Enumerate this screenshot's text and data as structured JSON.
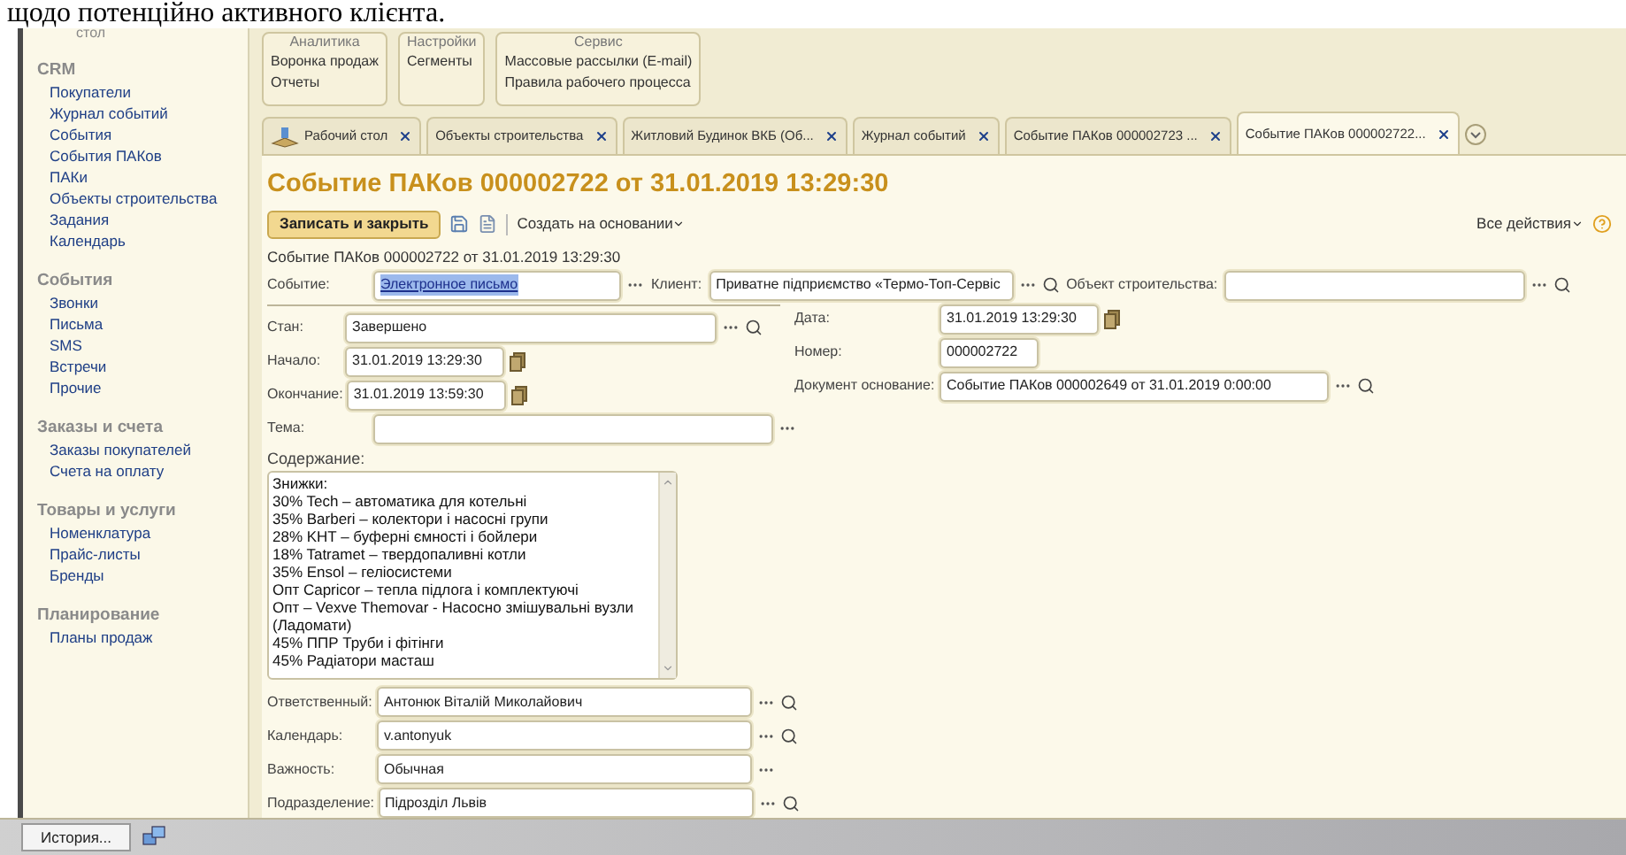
{
  "caption": "щодо потенційно активного клієнта.",
  "sidebar": {
    "top_item": "стол",
    "sections": [
      {
        "heading": "CRM",
        "items": [
          "Покупатели",
          "Журнал событий",
          "События",
          "События ПАКов",
          "ПАКи",
          "Объекты строительства",
          "Задания",
          "Календарь"
        ]
      },
      {
        "heading": "События",
        "items": [
          "Звонки",
          "Письма",
          "SMS",
          "Встречи",
          "Прочие"
        ]
      },
      {
        "heading": "Заказы и счета",
        "items": [
          "Заказы покупателей",
          "Счета на оплату"
        ]
      },
      {
        "heading": "Товары и услуги",
        "items": [
          "Номенклатура",
          "Прайс-листы",
          "Бренды"
        ]
      },
      {
        "heading": "Планирование",
        "items": [
          "Планы продаж"
        ]
      }
    ]
  },
  "command_groups": [
    {
      "title": "Аналитика",
      "items": [
        "Воронка продаж",
        "Отчеты"
      ]
    },
    {
      "title": "Настройки",
      "items": [
        "Сегменты"
      ]
    },
    {
      "title": "Сервис",
      "items": [
        "Массовые рассылки (E-mail)",
        "Правила рабочего процесса"
      ]
    }
  ],
  "tabs": [
    {
      "label": "Рабочий стол",
      "kind": "home",
      "selected": false
    },
    {
      "label": "Объекты строительства",
      "kind": "plain",
      "selected": false
    },
    {
      "label": "Житловий Будинок ВКБ (Об...",
      "kind": "plain",
      "selected": false
    },
    {
      "label": "Журнал событий",
      "kind": "plain",
      "selected": false
    },
    {
      "label": "Событие ПАКов 000002723 ...",
      "kind": "plain",
      "selected": false
    },
    {
      "label": "Событие ПАКов 000002722...",
      "kind": "plain",
      "selected": true
    }
  ],
  "form": {
    "title": "Событие ПАКов 000002722 от 31.01.2019 13:29:30",
    "save_button": "Записать и закрыть",
    "create_based_on": "Создать на основании",
    "all_actions": "Все действия",
    "subtitle": "Событие ПАКов 000002722 от 31.01.2019 13:29:30",
    "event": {
      "label": "Событие:",
      "value": "Электронное письмо",
      "kind": "select",
      "text_selected": true
    },
    "client": {
      "label": "Клиент:",
      "value": "Приватне підприємство «Термо-Топ-Сервіс",
      "kind": "lookup"
    },
    "site": {
      "label": "Объект строительства:",
      "kind": "lookup"
    },
    "left_fields": [
      {
        "label": "Стан:",
        "value": "Завершено",
        "kind": "lookup"
      },
      {
        "label": "Начало:",
        "value": "31.01.2019 13:29:30",
        "kind": "date"
      },
      {
        "label": "Окончание:",
        "value": "31.01.2019 13:59:30",
        "kind": "date"
      }
    ],
    "right_fields": [
      {
        "label": "Дата:",
        "value": "31.01.2019 13:29:30",
        "kind": "date"
      },
      {
        "label": "Номер:",
        "value": "000002722",
        "kind": "plain"
      },
      {
        "label": "Документ основание:",
        "value": "Событие ПАКов 000002649 от 31.01.2019 0:00:00",
        "kind": "lookup"
      }
    ],
    "subject": {
      "label": "Тема:",
      "kind": "select"
    },
    "content_label": "Содержание:",
    "content_lines": [
      "Знижки:",
      "30% Tech – автоматика для котельні",
      "35% Barberi – колектори і насосні групи",
      "28% KHT – буферні ємності і бойлери",
      "18% Tatramet – твердопаливні котли",
      "35% Ensol – геліосистеми",
      "Опт Capricor – тепла підлога і комплектуючі",
      "Опт – Vexve Themovar -  Насосно змішувальні вузли",
      "(Ладомати)",
      "45% ППР Труби і фітінги",
      "45% Радіатори масташ"
    ],
    "bottom_fields": [
      {
        "label": "Ответственный:",
        "value": "Антонюк Віталій Миколайович",
        "kind": "lookup"
      },
      {
        "label": "Календарь:",
        "value": "v.antonyuk",
        "kind": "lookup"
      },
      {
        "label": "Важность:",
        "value": "Обычная",
        "kind": "select"
      },
      {
        "label": "Подразделение:",
        "value": "Підрозділ Львів",
        "kind": "lookup"
      }
    ]
  },
  "taskbar": {
    "history_button": "История..."
  }
}
